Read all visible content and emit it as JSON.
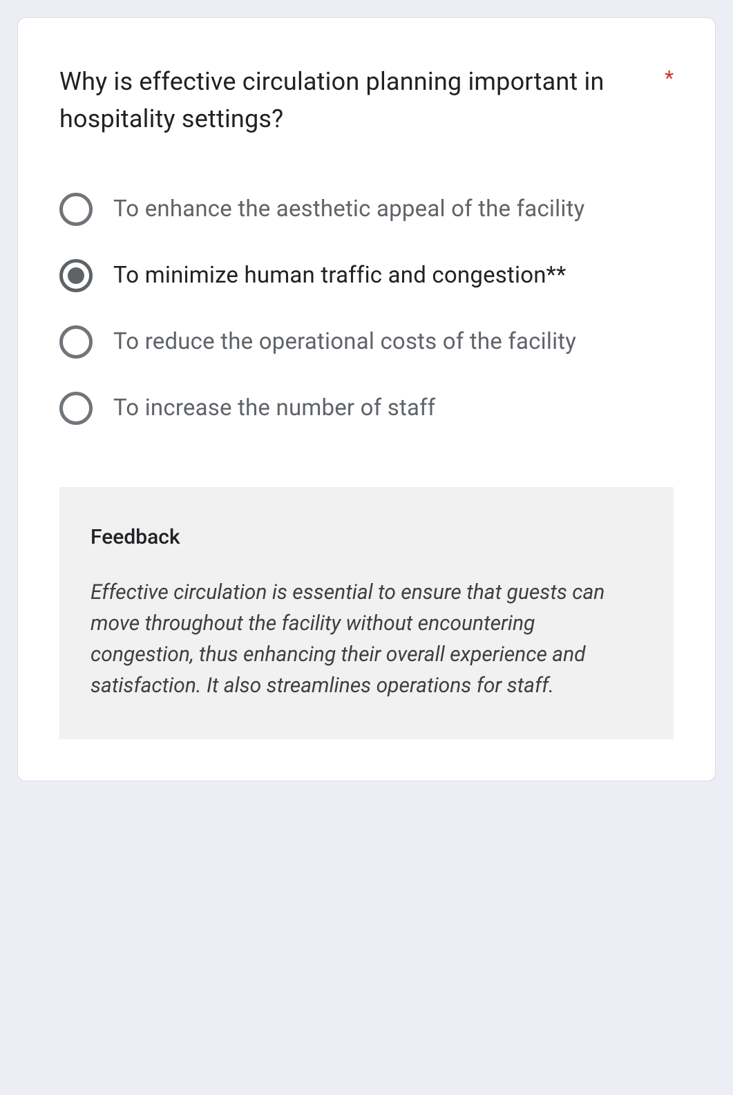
{
  "question": {
    "text": "Why is effective circulation planning important in hospitality settings?",
    "required_marker": "*"
  },
  "options": [
    {
      "label": "To enhance the aesthetic appeal of the facility",
      "selected": false
    },
    {
      "label": "To minimize human traffic and congestion**",
      "selected": true
    },
    {
      "label": "To reduce the operational costs of the facility",
      "selected": false
    },
    {
      "label": "To increase the number of staff",
      "selected": false
    }
  ],
  "feedback": {
    "title": "Feedback",
    "text": "Effective circulation is essential to ensure that guests can move throughout the facility without encountering congestion, thus enhancing their overall experience and satisfaction. It also streamlines operations for staff."
  }
}
